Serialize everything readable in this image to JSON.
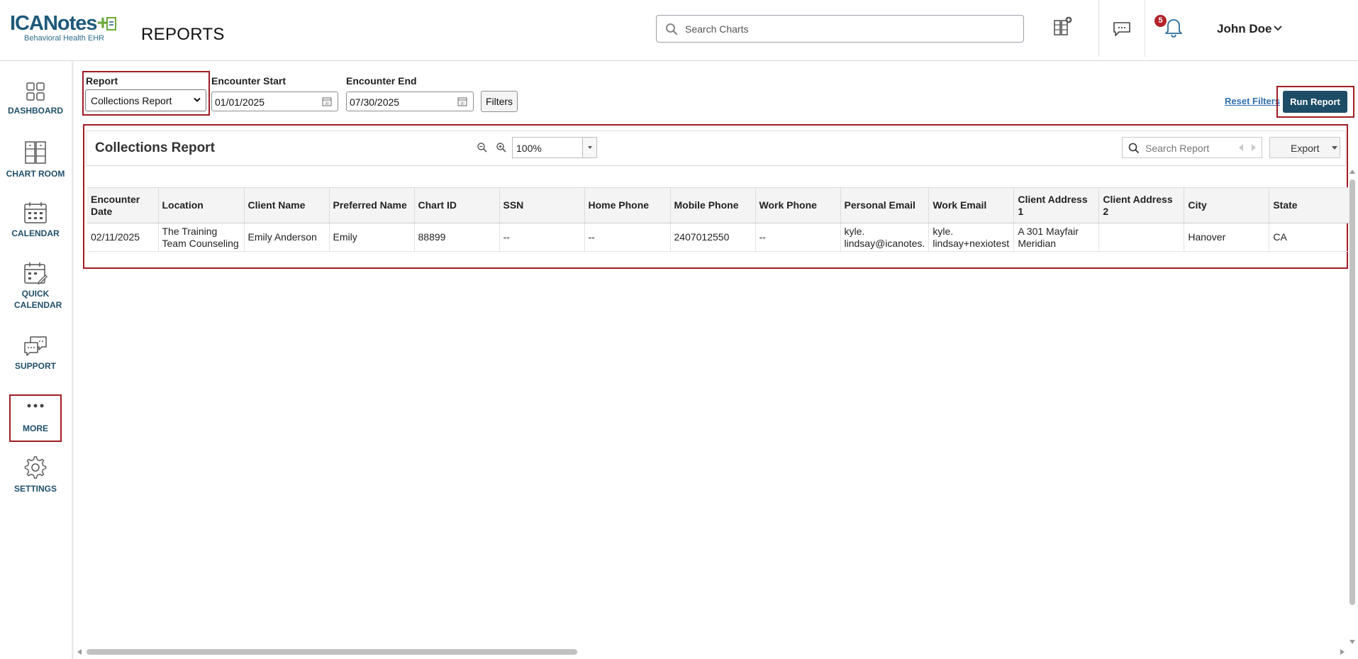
{
  "header": {
    "logo_main": "ICANotes",
    "logo_sub": "Behavioral Health EHR",
    "page_title": "REPORTS",
    "search_placeholder": "Search Charts",
    "notification_count": "5",
    "user_name": "John Doe"
  },
  "sidebar": {
    "items": [
      {
        "label": "DASHBOARD"
      },
      {
        "label": "CHART ROOM"
      },
      {
        "label": "CALENDAR"
      },
      {
        "label": "QUICK CALENDAR"
      },
      {
        "label": "SUPPORT"
      },
      {
        "label": "MORE"
      },
      {
        "label": "SETTINGS"
      }
    ]
  },
  "filters": {
    "report_label": "Report",
    "report_value": "Collections Report",
    "encounter_start_label": "Encounter Start",
    "encounter_start_value": "01/01/2025",
    "encounter_end_label": "Encounter End",
    "encounter_end_value": "07/30/2025",
    "filters_button": "Filters",
    "reset_filters": "Reset Filters",
    "run_report": "Run Report"
  },
  "report": {
    "title": "Collections Report",
    "zoom": "100%",
    "search_placeholder": "Search Report",
    "export_label": "Export",
    "columns": [
      "Encounter Date",
      "Location",
      "Client Name",
      "Preferred Name",
      "Chart ID",
      "SSN",
      "Home Phone",
      "Mobile Phone",
      "Work Phone",
      "Personal Email",
      "Work Email",
      "Client Address 1",
      "Client Address 2",
      "City",
      "State"
    ],
    "rows": [
      [
        "02/11/2025",
        "The Training Team Counseling",
        "Emily Anderson",
        "Emily",
        "88899",
        "--",
        "--",
        "2407012550",
        "--",
        "kyle. lindsay@icanotes.",
        "kyle. lindsay+nexiotest",
        "A 301 Mayfair Meridian",
        "",
        "Hanover",
        "CA"
      ]
    ]
  },
  "colors": {
    "brand_dark": "#1e5a7a",
    "brand_green": "#6aaa3a",
    "run_button": "#1d4d66",
    "highlight_border": "#a11c22",
    "badge": "#b3222a",
    "nav_text": "#1f4f6a"
  }
}
